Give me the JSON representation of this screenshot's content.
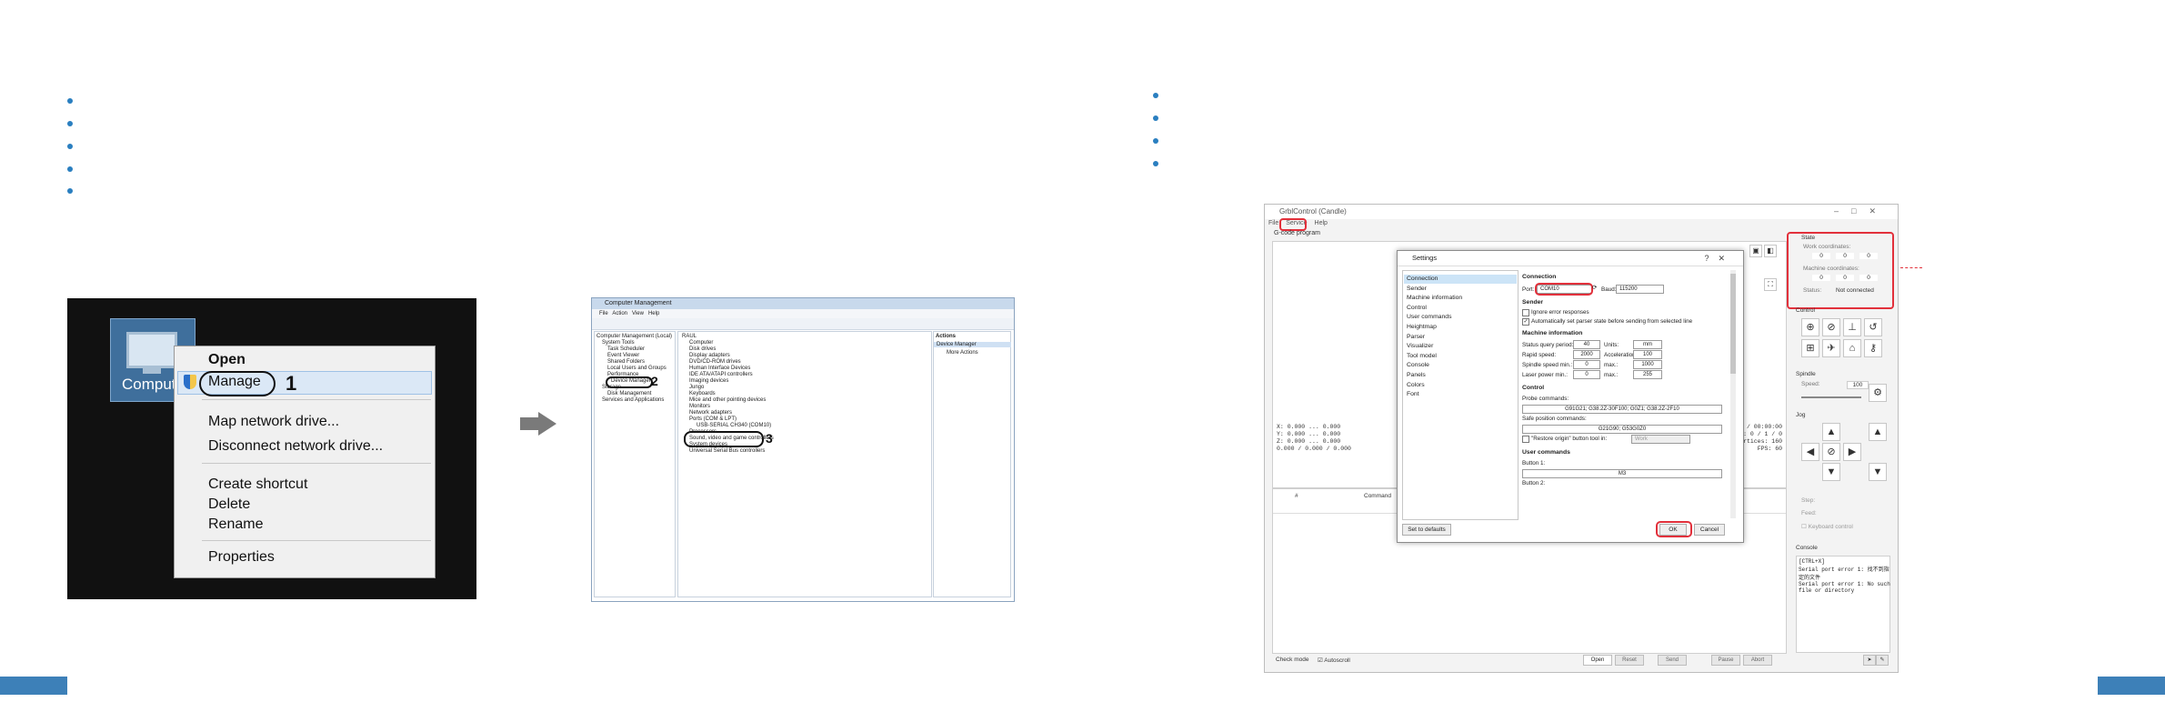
{
  "context_menu": {
    "desktop_icon_label": "Computer",
    "items": [
      "Open",
      "Manage",
      "Map network drive...",
      "Disconnect network drive...",
      "Create shortcut",
      "Delete",
      "Rename",
      "Properties"
    ],
    "step_number": "1"
  },
  "computer_management": {
    "title": "Computer Management",
    "menu": [
      "File",
      "Action",
      "View",
      "Help"
    ],
    "tree": [
      "Computer Management (Local)",
      "System Tools",
      "Task Scheduler",
      "Event Viewer",
      "Shared Folders",
      "Local Users and Groups",
      "Performance",
      "Device Manager",
      "Storage",
      "Disk Management",
      "Services and Applications"
    ],
    "device_root": "RAUL",
    "devices": [
      "Computer",
      "Disk drives",
      "Display adapters",
      "DVD/CD-ROM drives",
      "Human Interface Devices",
      "IDE ATA/ATAPI controllers",
      "Imaging devices",
      "Jungo",
      "Keyboards",
      "Mice and other pointing devices",
      "Monitors",
      "Network adapters",
      "Ports (COM & LPT)",
      "USB-SERIAL CH340 (COM10)",
      "Processors",
      "Sound, video and game controllers",
      "System devices",
      "Universal Serial Bus controllers"
    ],
    "actions_header": "Actions",
    "actions": [
      "Device Manager",
      "More Actions"
    ],
    "step2": "2",
    "step3": "3"
  },
  "candle": {
    "title": "GrblControl (Candle)",
    "menu": [
      "File",
      "Service",
      "Help"
    ],
    "gcode_label": "G-code program",
    "status_lines": [
      "X: 0.000 ... 0.000",
      "Y: 0.000 ... 0.000",
      "Z: 0.000 ... 0.000",
      "0.000 / 0.000 / 0.000"
    ],
    "status_right": [
      "00:00:00 / 00:00:00",
      "Buffer: 0 / 1 / 0",
      "Vertices: 160",
      "FPS: 60"
    ],
    "table_headers": [
      "#",
      "Command"
    ],
    "bottom_left": "Check mode",
    "autoscroll": "Autoscroll",
    "bottom_buttons": [
      "Open",
      "Reset",
      "Send",
      "Pause",
      "Abort"
    ],
    "state_header": "State",
    "work_coords_label": "Work coordinates:",
    "machine_coords_label": "Machine coordinates:",
    "coord_values": [
      "0",
      "0",
      "0"
    ],
    "status_label": "Status:",
    "status_value": "Not connected",
    "control_header": "Control",
    "spindle_header": "Spindle",
    "speed_label": "Speed:",
    "speed_value": "100",
    "jog_header": "Jog",
    "step_label": "Step:",
    "feed_label": "Feed:",
    "keyboard_control": "Keyboard control",
    "console_header": "Console",
    "console_text": "[CTRL+X]\nSerial port error 1: 找不到指\n定的文件\nSerial port error 1: No such\nfile or directory"
  },
  "settings": {
    "title": "Settings",
    "nav": [
      "Connection",
      "Sender",
      "Machine information",
      "Control",
      "User commands",
      "Heightmap",
      "Parser",
      "Visualizer",
      "Tool model",
      "Console",
      "Panels",
      "Colors",
      "Font"
    ],
    "connection_header": "Connection",
    "port_label": "Port:",
    "port_value": "COM10",
    "baud_label": "Baud:",
    "baud_value": "115200",
    "sender_header": "Sender",
    "ignore_errors": "Ignore error responses",
    "auto_parser": "Automatically set parser state before sending from selected line",
    "machine_header": "Machine information",
    "status_query_label": "Status query period:",
    "status_query_value": "40",
    "units_label": "Units:",
    "units_value": "mm",
    "rapid_label": "Rapid speed:",
    "rapid_value": "2000",
    "accel_label": "Acceleration:",
    "accel_value": "100",
    "spindle_min_label": "Spindle speed min.:",
    "spindle_min_value": "0",
    "max_label": "max.:",
    "spindle_max_value": "1000",
    "laser_min_label": "Laser power min.:",
    "laser_min_value": "0",
    "laser_max_value": "255",
    "control_header": "Control",
    "probe_label": "Probe commands:",
    "probe_value": "G91G21; G38.2Z-30F100; G0Z1; G38.2Z-2F10",
    "safe_label": "Safe position commands:",
    "safe_value": "G21G90; G53G0Z0",
    "restore_label": "\"Restore origin\" button tool in:",
    "restore_value": "Work",
    "user_header": "User commands",
    "button1_label": "Button 1:",
    "button1_value": "M3",
    "button2_label": "Button 2:",
    "set_defaults": "Set to defaults",
    "ok": "OK",
    "cancel": "Cancel"
  },
  "colors": {
    "accent_blue": "#2a7fc0",
    "highlight_red": "#e2303b",
    "corner_bar": "#3d80b8"
  }
}
